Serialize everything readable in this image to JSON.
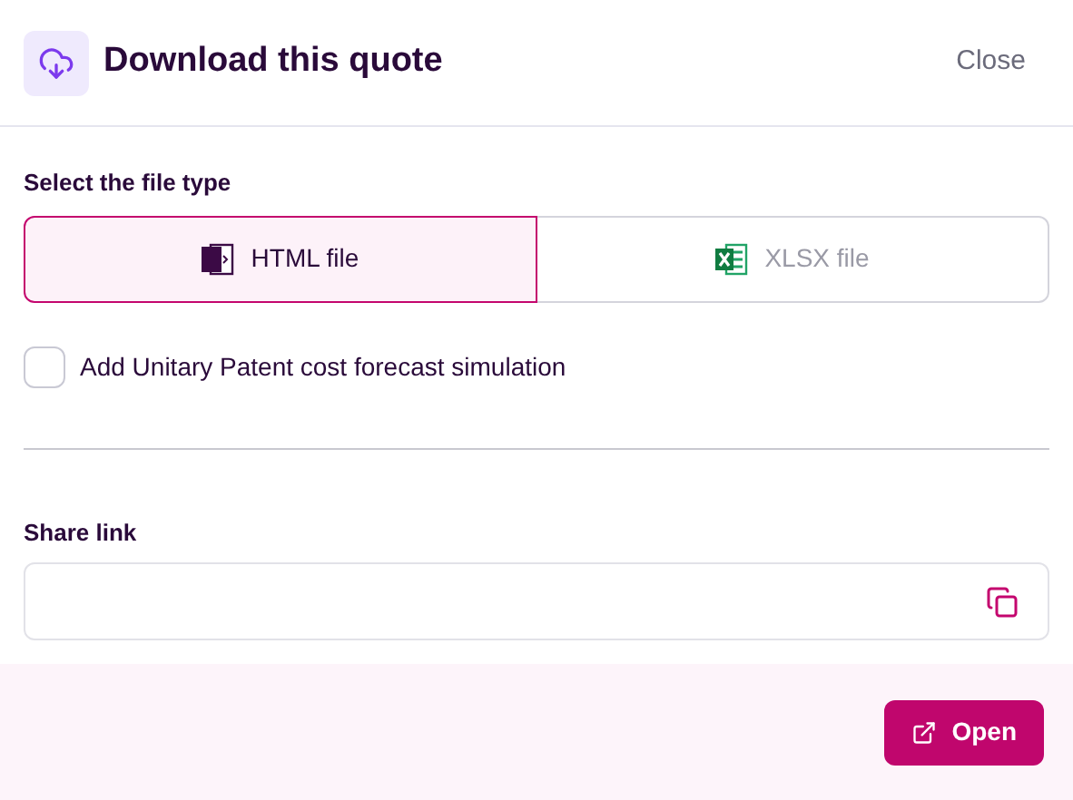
{
  "header": {
    "title": "Download this quote",
    "close": "Close"
  },
  "file_type": {
    "label": "Select the file type",
    "options": [
      {
        "kind": "html",
        "label": "HTML file",
        "selected": true
      },
      {
        "kind": "xlsx",
        "label": "XLSX file",
        "selected": false
      }
    ]
  },
  "simulation": {
    "label": "Add Unitary Patent cost forecast simulation",
    "checked": false
  },
  "share": {
    "label": "Share link"
  },
  "footer": {
    "open": "Open"
  }
}
